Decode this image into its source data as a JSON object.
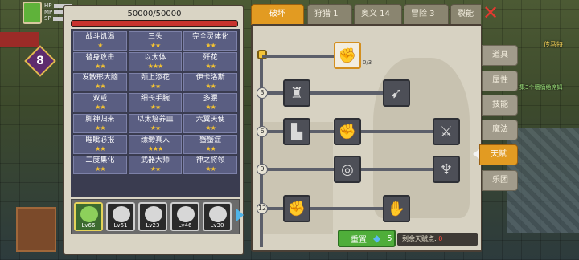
{
  "hud": {
    "stat_labels": [
      "HP",
      "MP",
      "SP"
    ],
    "level": "8"
  },
  "world_text": {
    "label_1": "传马特",
    "label_2": "集3个墙桶给席姆"
  },
  "left_panel": {
    "hp_text": "50000/50000",
    "hp_fraction": 1.0,
    "skills": [
      {
        "name": "战斗饥渴",
        "stars": "★"
      },
      {
        "name": "三头",
        "stars": "★★"
      },
      {
        "name": "完全灵体化",
        "stars": "★★"
      },
      {
        "name": "替身攻击",
        "stars": "★★"
      },
      {
        "name": "以太体",
        "stars": "★★★"
      },
      {
        "name": "歼花",
        "stars": "★★"
      },
      {
        "name": "发散形大脑",
        "stars": "★★"
      },
      {
        "name": "颈上添花",
        "stars": "★★"
      },
      {
        "name": "伊卡洛斯",
        "stars": "★★"
      },
      {
        "name": "双戒",
        "stars": "★★"
      },
      {
        "name": "细长手腕",
        "stars": "★★"
      },
      {
        "name": "多腰",
        "stars": "★★"
      },
      {
        "name": "脚神归来",
        "stars": "★★"
      },
      {
        "name": "以太培养皿",
        "stars": "★★"
      },
      {
        "name": "六翼天使",
        "stars": "★★"
      },
      {
        "name": "睚眦必报",
        "stars": "★★"
      },
      {
        "name": "缥缈真人",
        "stars": "★★★"
      },
      {
        "name": "蟹蟹症",
        "stars": "★★"
      },
      {
        "name": "二度集化",
        "stars": "★★"
      },
      {
        "name": "武器大师",
        "stars": "★★"
      },
      {
        "name": "神之将领",
        "stars": "★★"
      }
    ],
    "portraits": [
      {
        "level": "Lv66"
      },
      {
        "level": "Lv61"
      },
      {
        "level": "Lv23"
      },
      {
        "level": "Lv46"
      },
      {
        "level": "Lv30"
      }
    ]
  },
  "talent": {
    "tabs": [
      {
        "label": "破坏"
      },
      {
        "label": "狩猎 1"
      },
      {
        "label": "奥义 14"
      },
      {
        "label": "冒险 3"
      },
      {
        "label": "裂能"
      }
    ],
    "row_numbers": [
      "3",
      "6",
      "9",
      "12"
    ],
    "first_node_count": "0/3",
    "reset_label": "重置",
    "reset_cost": "5",
    "remaining_label": "剩余天赋点:",
    "remaining_value": "0",
    "node_icons": {
      "top": "arm-wrestle-icon",
      "r3a": "torso-icon",
      "r3b": "arrow-strike-icon",
      "r6a": "boot-icon",
      "r6b": "fist-punch-icon",
      "r6c": "sword-slash-icon",
      "r9a": "ground-ring-icon",
      "r9b": "demon-head-icon",
      "r12a": "raised-fist-icon",
      "r12b": "fist-icon"
    }
  },
  "side_tabs": [
    {
      "label": "道具"
    },
    {
      "label": "属性"
    },
    {
      "label": "技能"
    },
    {
      "label": "魔法"
    },
    {
      "label": "天赋"
    },
    {
      "label": "乐团"
    }
  ],
  "colors": {
    "accent": "#e29b22",
    "hp": "#c8332e",
    "panel": "#d7d2c2",
    "node_locked": "#4d4f57",
    "reset": "#4fae3a"
  }
}
